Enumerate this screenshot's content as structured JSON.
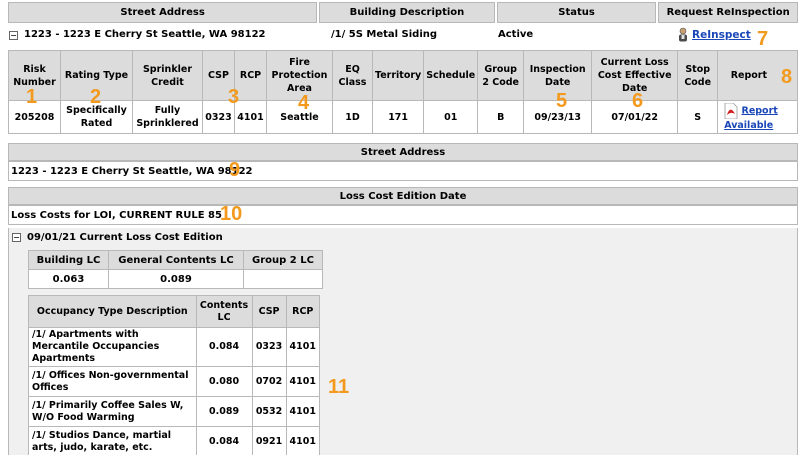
{
  "top_headers": {
    "street_address": "Street Address",
    "building_description": "Building Description",
    "status": "Status",
    "request_reinspection": "Request ReInspection"
  },
  "property": {
    "address": "1223 - 1223 E Cherry St Seattle, WA 98122",
    "building_description": "/1/ 5S Metal Siding",
    "status": "Active",
    "reinspect_label": "ReInspect"
  },
  "rating_table": {
    "headers": {
      "risk_number": "Risk Number",
      "rating_type": "Rating Type",
      "sprinkler_credit": "Sprinkler Credit",
      "csp": "CSP",
      "rcp": "RCP",
      "fire_protection_area": "Fire Protection Area",
      "eq_class": "EQ Class",
      "territory": "Territory",
      "schedule": "Schedule",
      "group2_code": "Group 2 Code",
      "inspection_date": "Inspection Date",
      "current_loss_cost_effective_date": "Current Loss Cost Effective Date",
      "stop_code": "Stop Code",
      "report": "Report"
    },
    "row": {
      "risk_number": "205208",
      "rating_type": "Specifically Rated",
      "sprinkler_credit": "Fully Sprinklered",
      "csp": "0323",
      "rcp": "4101",
      "fire_protection_area": "Seattle",
      "eq_class": "1D",
      "territory": "171",
      "schedule": "01",
      "group2_code": "B",
      "inspection_date": "09/23/13",
      "current_loss_cost_effective_date": "07/01/22",
      "stop_code": "S",
      "report_label": "Report Available"
    }
  },
  "street_section": {
    "header": "Street Address",
    "value": "1223 - 1223 E Cherry St Seattle, WA 98122"
  },
  "loss_cost_section": {
    "header": "Loss Cost Edition Date",
    "value": "Loss Costs for LOI, CURRENT RULE 85",
    "edition_label": "09/01/21 Current Loss Cost Edition"
  },
  "lc_table": {
    "headers": [
      "Building LC",
      "General Contents LC",
      "Group 2 LC"
    ],
    "values": [
      "0.063",
      "0.089",
      ""
    ]
  },
  "occupancy_table": {
    "headers": [
      "Occupancy Type Description",
      "Contents LC",
      "CSP",
      "RCP"
    ],
    "rows": [
      {
        "description": "/1/ Apartments with Mercantile Occupancies Apartments",
        "contents_lc": "0.084",
        "csp": "0323",
        "rcp": "4101"
      },
      {
        "description": "/1/ Offices Non-governmental Offices",
        "contents_lc": "0.080",
        "csp": "0702",
        "rcp": "4101"
      },
      {
        "description": "/1/ Primarily Coffee Sales W, W/O Food Warming",
        "contents_lc": "0.089",
        "csp": "0532",
        "rcp": "4101"
      },
      {
        "description": "/1/ Studios Dance, martial arts, judo, karate, etc.",
        "contents_lc": "0.084",
        "csp": "0921",
        "rcp": "4101"
      }
    ]
  },
  "callouts": [
    "1",
    "2",
    "3",
    "4",
    "5",
    "6",
    "7",
    "8",
    "9",
    "10",
    "11"
  ],
  "colors": {
    "callout": "#f39a1e",
    "header_bg": "#dcdcdc",
    "link": "#1a47b8"
  }
}
